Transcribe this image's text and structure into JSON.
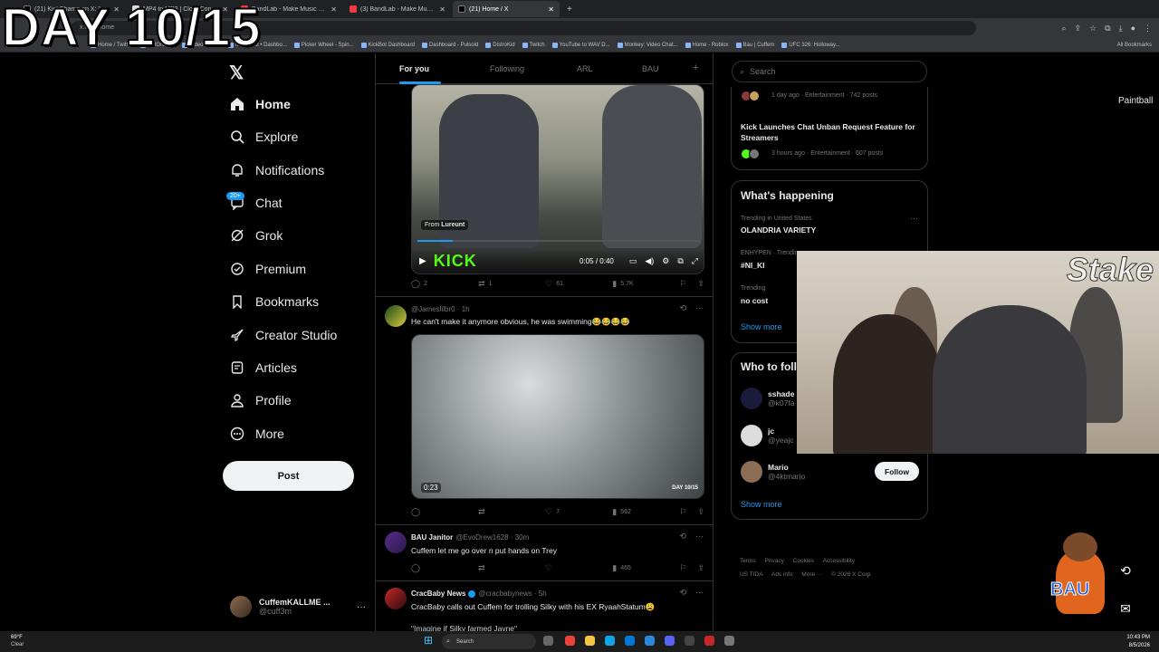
{
  "overlay": {
    "day_text": "DAY 10/15"
  },
  "browser": {
    "tabs": [
      {
        "label": "(21) KickChamp on X: \"Cuffem",
        "color": "#000000"
      },
      {
        "label": "MP4 to MP3 | CloudConvert",
        "color": "#ffffff"
      },
      {
        "label": "BandLab - Make Music Online",
        "color": "#f03c3c"
      },
      {
        "label": "(3) BandLab - Make Music Onli",
        "color": "#f03c3c"
      },
      {
        "label": "(21) Home / X",
        "color": "#000000"
      }
    ],
    "url": "x.com/home",
    "bookmarks": [
      "Home / Twitter",
      "OMONKEY",
      "Video Chat...",
      "IRLToolkit • Dashbo...",
      "Picker Wheel - Spin...",
      "KickBot Dashboard",
      "Dashboard - Pulsoid",
      "DistroKid",
      "Twitch",
      "YouTube to WAV D...",
      "Monkey: Video Chat...",
      "Home - Roblox",
      "Bau | Cuffem",
      "UFC 326: Holloway..."
    ],
    "all_bookmarks": "All Bookmarks"
  },
  "nav": {
    "logo": "𝕏",
    "items": [
      {
        "label": "Home",
        "icon": "home-icon"
      },
      {
        "label": "Explore",
        "icon": "search-icon"
      },
      {
        "label": "Notifications",
        "icon": "bell-icon"
      },
      {
        "label": "Chat",
        "icon": "chat-icon"
      },
      {
        "label": "Grok",
        "icon": "grok-icon"
      },
      {
        "label": "Premium",
        "icon": "premium-icon"
      },
      {
        "label": "Bookmarks",
        "icon": "bookmark-icon"
      },
      {
        "label": "Creator Studio",
        "icon": "rocket-icon"
      },
      {
        "label": "Articles",
        "icon": "article-icon"
      },
      {
        "label": "Profile",
        "icon": "person-icon"
      },
      {
        "label": "More",
        "icon": "more-icon"
      }
    ],
    "chat_badge": "20+",
    "post_label": "Post",
    "account": {
      "name": "CuffemKALLME ...",
      "handle": "@cuff3m",
      "more": "···"
    }
  },
  "feed": {
    "tabs": [
      "For you",
      "Following",
      "ARL",
      "BAU"
    ],
    "add_tab": "+",
    "post1": {
      "from_label": "From",
      "from_user": "Lureunt",
      "brand": "KICK",
      "time": "0:05 / 0:40",
      "progress": 0.125,
      "replies": "2",
      "reposts": "1",
      "likes": "61",
      "views": "5.7K"
    },
    "post2": {
      "handle": "@Jameslilbr0",
      "time": "1h",
      "text": "He can't make it anymore obvious, he was swimming😂😂😂😂",
      "duration": "0:23",
      "corner": "DAY 10/15",
      "replies": "",
      "reposts": "",
      "likes": "7",
      "views": "562"
    },
    "post3": {
      "name": "BAU Janitor",
      "handle": "@EvoDrew1628",
      "time": "30m",
      "text": "Cuffem let me go over n put hands on Trey",
      "views": "465"
    },
    "post4": {
      "name": "CracBaby News",
      "handle": "@cracbabynews",
      "time": "5h",
      "text": "CracBaby calls out Cuffem for trolling Silky with his EX RyaahStatum😩",
      "quote": "\"Imagine if Silky farmed Jayne\""
    }
  },
  "right": {
    "search_placeholder": "Search",
    "news": [
      {
        "meta": "1 day ago · Entertainment · 742 posts",
        "title": ""
      },
      {
        "meta": "3 hours ago · Entertainment · 607 posts",
        "title": "Kick Launches Chat Unban Request Feature for Streamers"
      }
    ],
    "happening_title": "What's happening",
    "trends": [
      {
        "context": "Trending in United States",
        "name": "OLANDRIA VARIETY"
      },
      {
        "context": "ENHYPEN · Trending",
        "name": "#NI_KI"
      },
      {
        "context": "Trending",
        "name": "no cost"
      }
    ],
    "show_more": "Show more",
    "who_title": "Who to follow",
    "who": [
      {
        "name": "sshade",
        "handle": "@k07fa"
      },
      {
        "name": "jc",
        "handle": "@yeajc"
      },
      {
        "name": "Mario",
        "handle": "@4ktmario"
      }
    ],
    "follow_label": "Follow",
    "footer": [
      "Terms",
      "Privacy",
      "Cookies",
      "Accessibility",
      "US TIDA",
      "Ads info",
      "More ···",
      "© 2026 X Corp."
    ],
    "side_label": "Paintball"
  },
  "webcam": {
    "brand": "Stake"
  },
  "mascot": {
    "text": "BAU"
  },
  "taskbar": {
    "temp": "69°F",
    "weather": "Clear",
    "search": "Search",
    "time": "10:43 PM",
    "date": "8/5/2026"
  }
}
